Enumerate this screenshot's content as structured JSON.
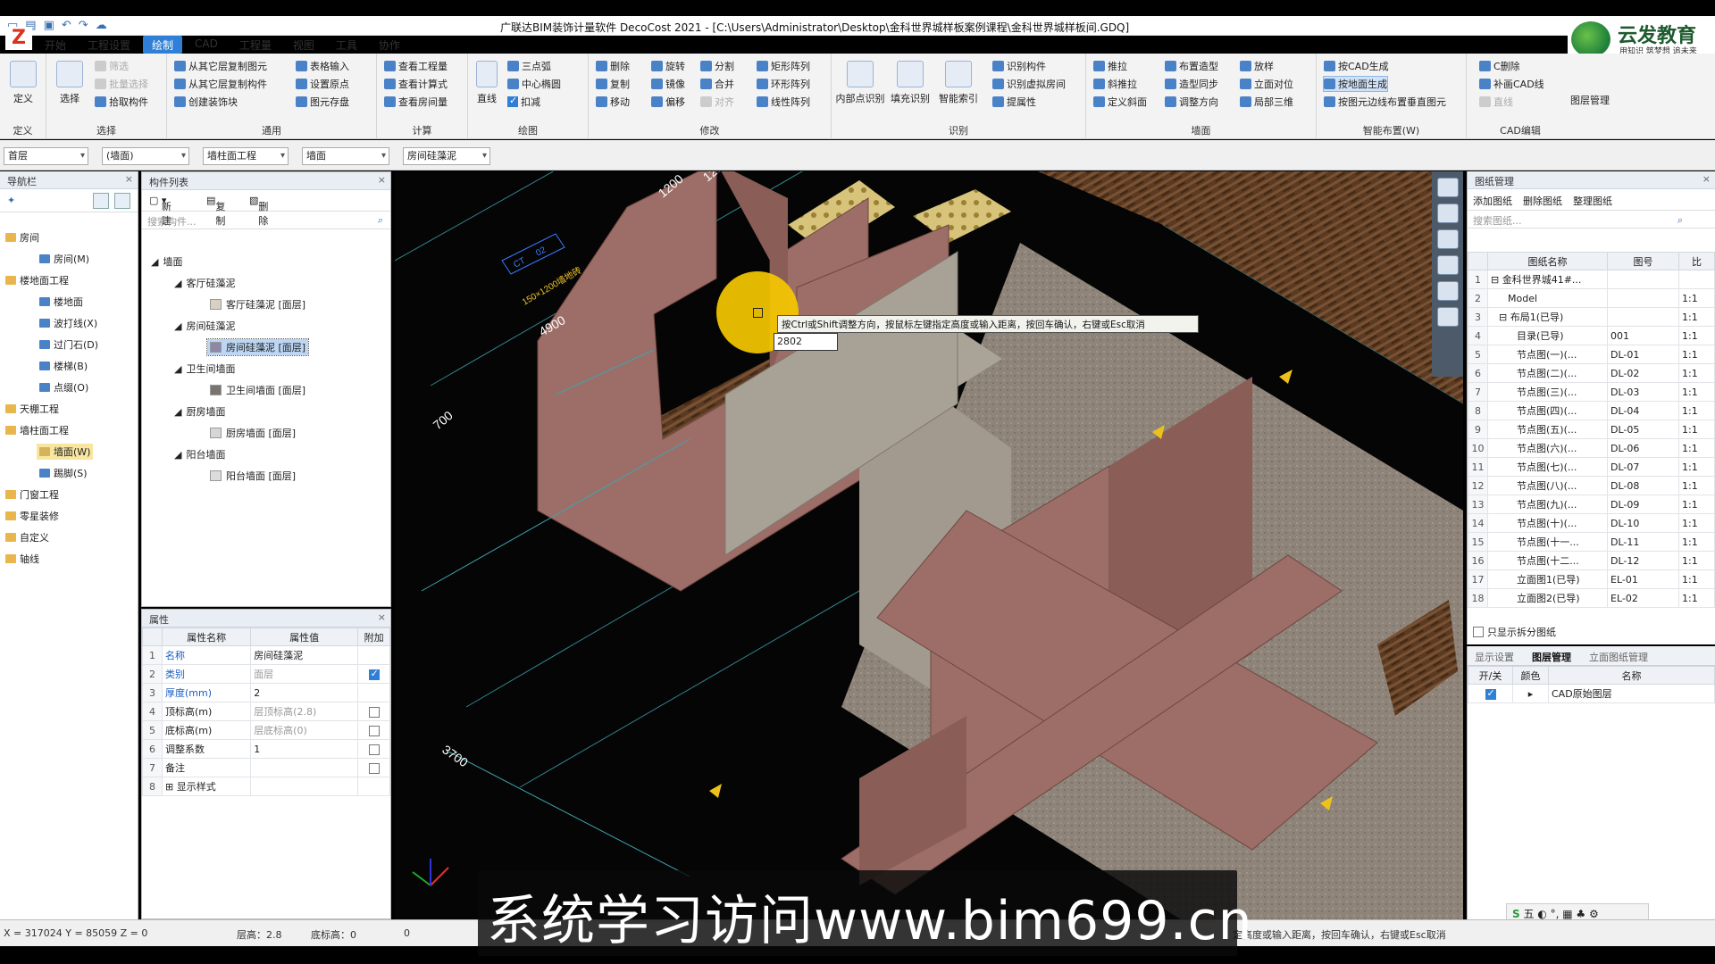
{
  "app": {
    "title": "广联达BIM装饰计量软件 DecoCost 2021 - [C:\\Users\\Administrator\\Desktop\\金科世界城样板案例课程\\金科世界城样板间.GDQ]",
    "logo_letter": "Z"
  },
  "brand": {
    "name": "云发教育",
    "slogan": "用知识 筑梦想 追未来"
  },
  "menu": [
    "开始",
    "工程设置",
    "绘制",
    "CAD",
    "工程量",
    "视图",
    "工具",
    "协作"
  ],
  "ribbon": {
    "define": {
      "label": "定义",
      "group": "定义"
    },
    "select": {
      "label": "选择",
      "filter": "筛选",
      "batch": "批量选择",
      "pick": "拾取构件",
      "group": "选择"
    },
    "general": {
      "items": [
        "从其它层复制图元",
        "从其它层复制构件",
        "创建装饰块",
        "表格输入",
        "设置原点",
        "图元存盘"
      ],
      "group": "通用"
    },
    "calc": {
      "items": [
        "查看工程量",
        "查看计算式",
        "查看房间量"
      ],
      "group": "计算"
    },
    "draw": {
      "line": "直线",
      "items": [
        "三点弧",
        "中心椭圆",
        "扣减"
      ],
      "group": "绘图"
    },
    "modify": {
      "items": [
        "删除",
        "旋转",
        "分割",
        "矩形阵列",
        "复制",
        "镜像",
        "合并",
        "环形阵列",
        "移动",
        "偏移",
        "对齐",
        "线性阵列"
      ],
      "group": "修改"
    },
    "recog": {
      "big": [
        "内部点识别",
        "填充识别",
        "智能索引"
      ],
      "items": [
        "识别构件",
        "识别虚拟房间",
        "提属性"
      ],
      "group": "识别"
    },
    "wall": {
      "items": [
        "推拉",
        "布置造型",
        "放样",
        "斜推拉",
        "造型同步",
        "立面对位",
        "定义斜面",
        "调整方向",
        "局部三维"
      ],
      "group": "墙面"
    },
    "smart": {
      "items": [
        "按CAD生成",
        "按地面生成",
        "按图元边线布置垂直图元"
      ],
      "group": "智能布置(W)"
    },
    "cad": {
      "items": [
        "C删除",
        "补画CAD线",
        "直线"
      ],
      "group": "CAD编辑",
      "layer": "图层管理"
    }
  },
  "filters": [
    "首层",
    "(墙面)",
    "墙柱面工程",
    "墙面",
    "房间硅藻泥"
  ],
  "nav": {
    "title": "导航栏",
    "items": [
      {
        "label": "房间",
        "type": "folder"
      },
      {
        "label": "房间(M)",
        "type": "child"
      },
      {
        "label": "楼地面工程",
        "type": "folder"
      },
      {
        "label": "楼地面",
        "type": "child"
      },
      {
        "label": "波打线(X)",
        "type": "child"
      },
      {
        "label": "过门石(D)",
        "type": "child"
      },
      {
        "label": "楼梯(B)",
        "type": "child"
      },
      {
        "label": "点缀(O)",
        "type": "child"
      },
      {
        "label": "天棚工程",
        "type": "folder"
      },
      {
        "label": "墙柱面工程",
        "type": "folder"
      },
      {
        "label": "墙面(W)",
        "type": "child"
      },
      {
        "label": "踢脚(S)",
        "type": "child"
      },
      {
        "label": "门窗工程",
        "type": "folder"
      },
      {
        "label": "零星装修",
        "type": "folder"
      },
      {
        "label": "自定义",
        "type": "folder"
      },
      {
        "label": "轴线",
        "type": "folder"
      }
    ]
  },
  "components": {
    "title": "构件列表",
    "new": "新建",
    "copy": "复制",
    "delete": "删除",
    "search_placeholder": "搜索构件...",
    "tree": [
      {
        "label": "墙面",
        "level": 0
      },
      {
        "label": "客厅硅藻泥",
        "level": 1
      },
      {
        "label": "客厅硅藻泥 [面层]",
        "level": 2,
        "color": "#d8d1c3"
      },
      {
        "label": "房间硅藻泥",
        "level": 1
      },
      {
        "label": "房间硅藻泥 [面层]",
        "level": 2,
        "color": "#8e88a8",
        "selected": true
      },
      {
        "label": "卫生间墙面",
        "level": 1
      },
      {
        "label": "卫生间墙面 [面层]",
        "level": 2,
        "color": "#7a7470"
      },
      {
        "label": "厨房墙面",
        "level": 1
      },
      {
        "label": "厨房墙面 [面层]",
        "level": 2,
        "color": "#d6d6d6"
      },
      {
        "label": "阳台墙面",
        "level": 1
      },
      {
        "label": "阳台墙面 [面层]",
        "level": 2,
        "color": "#dcdcdc"
      }
    ]
  },
  "properties": {
    "title": "属性",
    "headers": [
      "属性名称",
      "属性值",
      "附加"
    ],
    "rows": [
      {
        "n": "1",
        "name": "名称",
        "value": "房间硅藻泥",
        "extra": "",
        "blue": true,
        "gray": false
      },
      {
        "n": "2",
        "name": "类别",
        "value": "面层",
        "extra": "on",
        "blue": true,
        "gray": true
      },
      {
        "n": "3",
        "name": "厚度(mm)",
        "value": "2",
        "extra": "",
        "blue": true,
        "gray": false
      },
      {
        "n": "4",
        "name": "顶标高(m)",
        "value": "层顶标高(2.8)",
        "extra": "off",
        "blue": false,
        "gray": true
      },
      {
        "n": "5",
        "name": "底标高(m)",
        "value": "层底标高(0)",
        "extra": "off",
        "blue": false,
        "gray": true
      },
      {
        "n": "6",
        "name": "调整系数",
        "value": "1",
        "extra": "off",
        "blue": false,
        "gray": false
      },
      {
        "n": "7",
        "name": "备注",
        "value": "",
        "extra": "off",
        "blue": false,
        "gray": false
      },
      {
        "n": "8",
        "name": "显示样式",
        "value": "",
        "extra": "",
        "blue": false,
        "gray": false
      }
    ]
  },
  "viewport": {
    "tooltip": "按Ctrl或Shift调整方向，按鼠标左键指定高度或输入距离，按回车确认，右键或Esc取消",
    "input_value": "2802",
    "dims": [
      "1200",
      "4900",
      "700",
      "3700",
      "1200"
    ],
    "tags": [
      "CT",
      "02",
      "150×1200墙地砖"
    ]
  },
  "drawings": {
    "title": "图纸管理",
    "actions": [
      "添加图纸",
      "删除图纸",
      "整理图纸"
    ],
    "search_placeholder": "搜索图纸...",
    "headers": [
      "图纸名称",
      "图号",
      "比"
    ],
    "rows": [
      {
        "n": "1",
        "name": "金科世界城41#...",
        "code": "",
        "scale": ""
      },
      {
        "n": "2",
        "name": "Model",
        "code": "",
        "scale": "1:1"
      },
      {
        "n": "3",
        "name": "布局1(已导)",
        "code": "",
        "scale": "1:1"
      },
      {
        "n": "4",
        "name": "目录(已导)",
        "code": "001",
        "scale": "1:1"
      },
      {
        "n": "5",
        "name": "节点图(一)(...",
        "code": "DL-01",
        "scale": "1:1"
      },
      {
        "n": "6",
        "name": "节点图(二)(...",
        "code": "DL-02",
        "scale": "1:1"
      },
      {
        "n": "7",
        "name": "节点图(三)(...",
        "code": "DL-03",
        "scale": "1:1"
      },
      {
        "n": "8",
        "name": "节点图(四)(...",
        "code": "DL-04",
        "scale": "1:1"
      },
      {
        "n": "9",
        "name": "节点图(五)(...",
        "code": "DL-05",
        "scale": "1:1"
      },
      {
        "n": "10",
        "name": "节点图(六)(...",
        "code": "DL-06",
        "scale": "1:1"
      },
      {
        "n": "11",
        "name": "节点图(七)(...",
        "code": "DL-07",
        "scale": "1:1"
      },
      {
        "n": "12",
        "name": "节点图(八)(...",
        "code": "DL-08",
        "scale": "1:1"
      },
      {
        "n": "13",
        "name": "节点图(九)(...",
        "code": "DL-09",
        "scale": "1:1"
      },
      {
        "n": "14",
        "name": "节点图(十)(...",
        "code": "DL-10",
        "scale": "1:1"
      },
      {
        "n": "15",
        "name": "节点图(十一...",
        "code": "DL-11",
        "scale": "1:1"
      },
      {
        "n": "16",
        "name": "节点图(十二...",
        "code": "DL-12",
        "scale": "1:1"
      },
      {
        "n": "17",
        "name": "立面图1(已导)",
        "code": "EL-01",
        "scale": "1:1"
      },
      {
        "n": "18",
        "name": "立面图2(已导)",
        "code": "EL-02",
        "scale": "1:1"
      }
    ],
    "split_only": "只显示拆分图纸"
  },
  "layers": {
    "tabs": [
      "显示设置",
      "图层管理",
      "立面图纸管理"
    ],
    "headers": [
      "开/关",
      "颜色",
      "名称"
    ],
    "row": "CAD原始图层"
  },
  "status": {
    "coords": "X = 317024 Y = 85059 Z = 0",
    "floor_height": "层高：2.8",
    "base_height": "底标高：0",
    "zero": "0",
    "hint": "定高度或输入距离，按回车确认，右键或Esc取消"
  },
  "ime": "五",
  "watermark": "系统学习访问www.bim699.cn"
}
